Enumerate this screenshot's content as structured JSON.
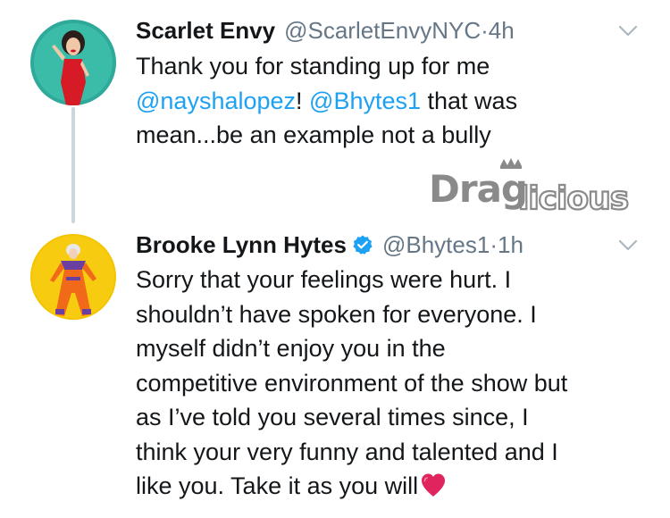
{
  "tweets": [
    {
      "name": "Scarlet Envy",
      "handle": "@ScarletEnvyNYC",
      "time": "4h",
      "verified": false,
      "text_line1": "Thank you for standing up for me",
      "mention1": "@nayshalopez",
      "after_mention1": "! ",
      "mention2": "@Bhytes1",
      "after_mention2": " that was",
      "text_line3": "mean...be an example not a bully"
    },
    {
      "name": "Brooke Lynn Hytes",
      "handle": "@Bhytes1",
      "time": "1h",
      "verified": true,
      "lines": [
        "Sorry that your feelings were hurt. I",
        "shouldn’t have spoken for everyone. I",
        "myself didn’t enjoy you in the",
        "competitive environment of the show but",
        "as I’ve told you several times since, I",
        "think your very funny and talented and I",
        "like you.  Take it as you will"
      ]
    }
  ],
  "separator": " · ",
  "watermark": "Draglicious",
  "colors": {
    "link": "#1da1f2",
    "secondary": "#657786",
    "text": "#14171a",
    "thread_line": "#ccd6dd",
    "heart": "#e0245e"
  },
  "icons": {
    "verified": "verified-badge-icon",
    "caret": "chevron-down-icon",
    "heart": "red-heart-emoji-icon"
  }
}
